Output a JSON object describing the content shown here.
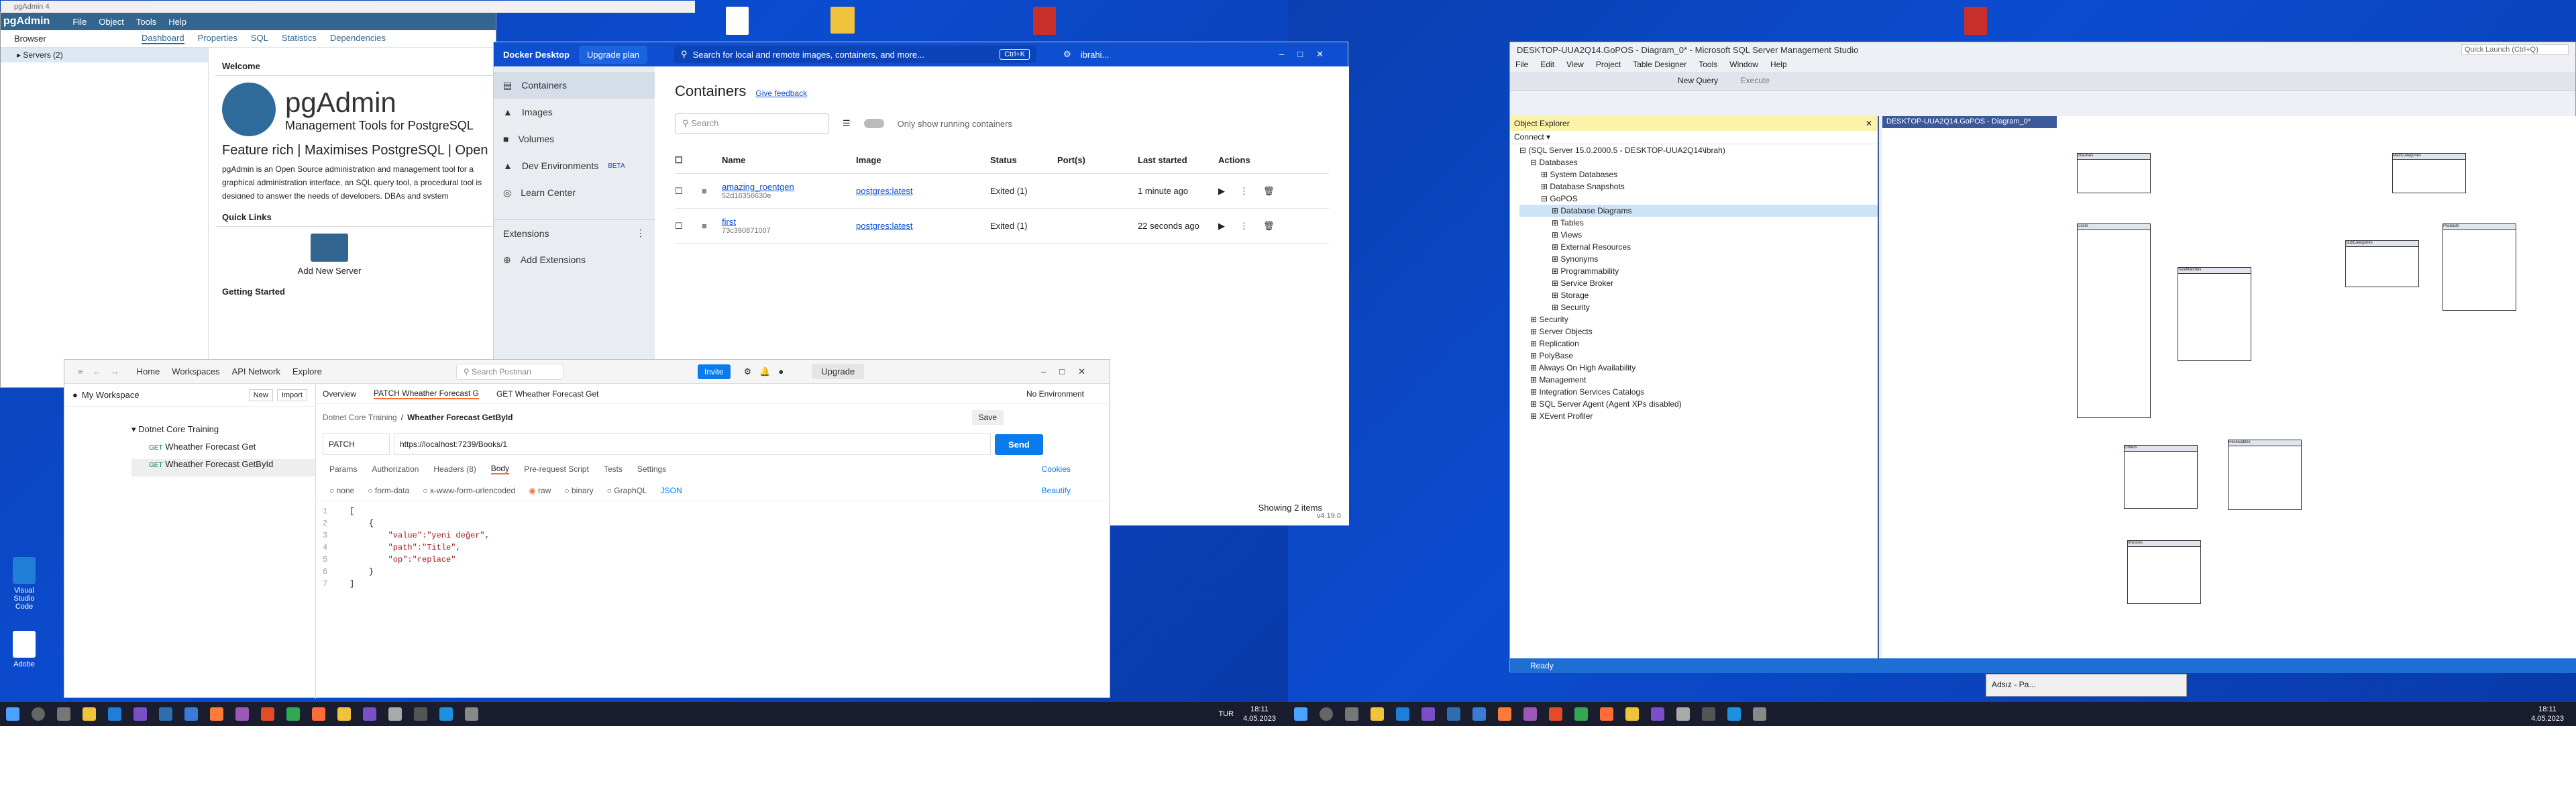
{
  "pgadmin": {
    "window_title": "pgAdmin 4",
    "logo": "pgAdmin",
    "menu": [
      "File",
      "Object",
      "Tools",
      "Help"
    ],
    "browser": "Browser",
    "tabs": [
      "Dashboard",
      "Properties",
      "SQL",
      "Statistics",
      "Dependencies"
    ],
    "tree_servers": "Servers (2)",
    "welcome": "Welcome",
    "brand_title": "pgAdmin",
    "brand_sub": "Management Tools for PostgreSQL",
    "tagline": "Feature rich | Maximises PostgreSQL | Open",
    "desc": "pgAdmin is an Open Source administration and management tool for a graphical administration interface, an SQL query tool, a procedural tool is designed to answer the needs of developers, DBAs and system",
    "quick_links": "Quick Links",
    "add_server": "Add New Server",
    "getting_started": "Getting Started"
  },
  "docker": {
    "brand": "Docker Desktop",
    "upgrade": "Upgrade plan",
    "search_placeholder": "Search for local and remote images, containers, and more...",
    "shortcut": "Ctrl+K",
    "user": "ibrahi...",
    "nav": [
      "Containers",
      "Images",
      "Volumes",
      "Dev Environments",
      "Learn Center"
    ],
    "beta": "BETA",
    "extensions": "Extensions",
    "add_ext": "Add Extensions",
    "heading": "Containers",
    "feedback": "Give feedback",
    "search": "Search",
    "toggle_label": "Only show running containers",
    "columns": [
      "Name",
      "Image",
      "Status",
      "Port(s)",
      "Last started",
      "Actions"
    ],
    "rows": [
      {
        "name": "amazing_roentgen",
        "id": "52d16356630e",
        "image": "postgres:latest",
        "status": "Exited (1)",
        "ports": "",
        "started": "1 minute ago"
      },
      {
        "name": "first",
        "id": "73c390871007",
        "image": "postgres:latest",
        "status": "Exited (1)",
        "ports": "",
        "started": "22 seconds ago"
      }
    ],
    "footer": "Showing 2 items",
    "version": "v4.19.0"
  },
  "postman": {
    "nav": [
      "Home",
      "Workspaces",
      "API Network",
      "Explore"
    ],
    "search": "Search Postman",
    "invite": "Invite",
    "upgrade": "Upgrade",
    "workspace": "My Workspace",
    "new": "New",
    "import": "Import",
    "tab_overview": "Overview",
    "tab_active": "PATCH Wheather Forecast G",
    "tab_get": "GET Wheather Forecast Get",
    "env": "No Environment",
    "collection": "Dotnet Core Training",
    "items": [
      {
        "method": "GET",
        "label": "Wheather Forecast Get"
      },
      {
        "method": "GET",
        "label": "Wheather Forecast GetById"
      }
    ],
    "breadcrumb_parent": "Dotnet Core Training",
    "breadcrumb_current": "Wheather Forecast GetById",
    "save": "Save",
    "method": "PATCH",
    "url": "https://localhost:7239/Books/1",
    "send": "Send",
    "req_tabs": [
      "Params",
      "Authorization",
      "Headers (8)",
      "Body",
      "Pre-request Script",
      "Tests",
      "Settings"
    ],
    "cookies": "Cookies",
    "body_types": [
      "none",
      "form-data",
      "x-www-form-urlencoded",
      "raw",
      "binary",
      "GraphQL"
    ],
    "lang": "JSON",
    "beautify": "Beautify",
    "code": [
      "[",
      "    {",
      "        \"value\":\"yeni değer\",",
      "        \"path\":\"Title\",",
      "        \"op\":\"replace\"",
      "    }",
      "]"
    ]
  },
  "ssms": {
    "title": "DESKTOP-UUA2Q14.GoPOS - Diagram_0* - Microsoft SQL Server Management Studio",
    "quick_launch": "Quick Launch (Ctrl+Q)",
    "menu": [
      "File",
      "Edit",
      "View",
      "Project",
      "Table Designer",
      "Tools",
      "Window",
      "Help"
    ],
    "new_query": "New Query",
    "execute": "Execute",
    "oe_title": "Object Explorer",
    "connect": "Connect",
    "diag_tab": "DESKTOP-UUA2Q14.GoPOS - Diagram_0*",
    "tree": [
      "(SQL Server 15.0.2000.5 - DESKTOP-UUA2Q14\\ibrah)",
      "Databases",
      "System Databases",
      "Database Snapshots",
      "GoPOS",
      "Database Diagrams",
      "Tables",
      "Views",
      "External Resources",
      "Synonyms",
      "Programmability",
      "Service Broker",
      "Storage",
      "Security",
      "Security",
      "Server Objects",
      "Replication",
      "PolyBase",
      "Always On High Availability",
      "Management",
      "Integration Services Catalogs",
      "SQL Server Agent (Agent XPs disabled)",
      "XEvent Profiler"
    ],
    "status": "Ready",
    "tables": [
      "Statuses",
      "MainCategories",
      "Products",
      "SubCategories",
      "Users",
      "SizeMatches",
      "Orders",
      "Receivables",
      "Invoices"
    ]
  },
  "adobe_mini": "Adsız - Pa...",
  "taskbar": {
    "lang": "TUR",
    "time": "18:11",
    "date": "4.05.2023"
  },
  "desktop_icons": [
    "Visual Studio Code",
    "Adobe"
  ]
}
